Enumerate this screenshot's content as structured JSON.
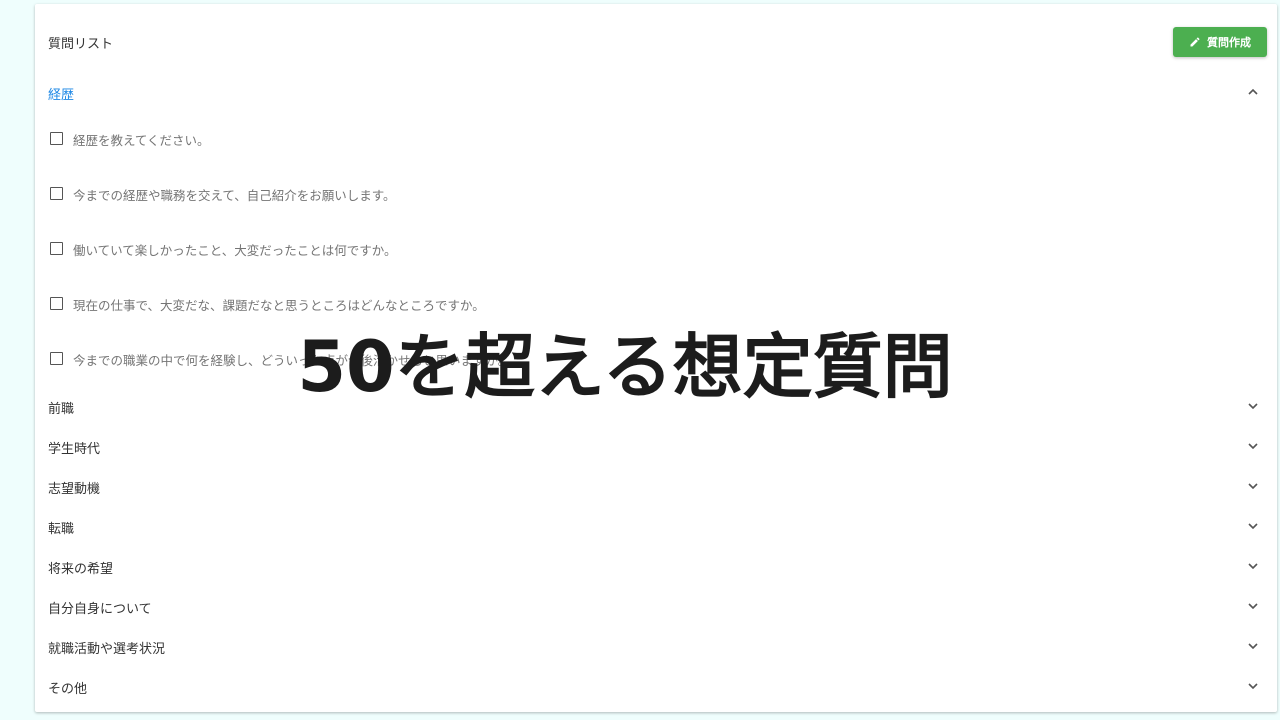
{
  "header": {
    "title": "質問リスト",
    "create_button_label": "質問作成",
    "create_button_icon": "pencil-icon",
    "accent_color": "#4caf50"
  },
  "open_section": {
    "label": "経歴",
    "label_color": "#1e88e5",
    "chevron": "chevron-up-icon",
    "questions": [
      "経歴を教えてください。",
      "今までの経歴や職務を交えて、自己紹介をお願いします。",
      "働いていて楽しかったこと、大変だったことは何ですか。",
      "現在の仕事で、大変だな、課題だなと思うところはどんなところですか。",
      "今までの職業の中で何を経験し、どういった点が今後活かせると思いますか。"
    ]
  },
  "collapsed_sections": [
    "前職",
    "学生時代",
    "志望動機",
    "転職",
    "将来の希望",
    "自分自身について",
    "就職活動や選考状況",
    "その他"
  ],
  "overlay": {
    "text": "50を超える想定質問"
  }
}
